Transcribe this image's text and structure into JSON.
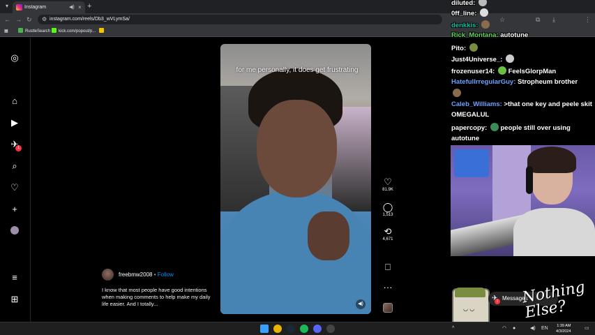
{
  "browser": {
    "tab": {
      "title": "Instagram",
      "audio_icon": "speaker-icon",
      "close_glyph": "×"
    },
    "new_tab_glyph": "+",
    "url": "instagram.com/reels/Db3_wVLymSa/",
    "bookmarks": [
      {
        "label": "RustleSearch",
        "icon": "rustle-icon",
        "color": "#4caf50"
      },
      {
        "label": "kick.com/popout/p...",
        "icon": "kick-icon",
        "color": "#53fc18"
      },
      {
        "label": "",
        "icon": "bookmark-folder-icon",
        "color": "#f5c400"
      }
    ]
  },
  "instagram": {
    "nav_icons": [
      "instagram-logo-icon",
      "home-icon",
      "reels-icon",
      "notifications-icon",
      "search-icon",
      "heart-icon",
      "create-icon",
      "profile-avatar",
      "menu-icon",
      "apps-icon"
    ],
    "notification_count": "1",
    "reel": {
      "caption_overlay": "for me personally, it does get frustrating",
      "likes": "81.9K",
      "comments": "1,513",
      "reposts": "4,671",
      "author": "freebmw2008",
      "separator": "•",
      "follow_label": "Follow",
      "description": "I know that most people have good intentions when making comments to help make my daily life easier. And I totally..."
    }
  },
  "chat": {
    "messages": [
      {
        "user": "diluted:",
        "text": "",
        "color": "#ffffff",
        "emote": "#bbbbbb"
      },
      {
        "user": "0ff_line:",
        "text": "",
        "color": "#ffffff",
        "emote": "#dddddd"
      },
      {
        "user": "denkkis:",
        "text": "",
        "color": "#00c2a8",
        "emote": "#8b6b4e"
      },
      {
        "user": "Rick_Montana:",
        "text": "autotune",
        "color": "#5bd75b",
        "emote": ""
      },
      {
        "user": "Pito:",
        "text": "",
        "color": "#ffffff",
        "emote": "#7a8c40"
      },
      {
        "user": "Just4Universe_:",
        "text": "",
        "color": "#ffffff",
        "emote": "#cccccc"
      },
      {
        "user": "frozenuser14:",
        "text": "FeelsGlorpMan",
        "color": "#ffffff",
        "emote": "#6abf40"
      },
      {
        "user": "HatefulIrregularGuy:",
        "text": "Stropheum brother",
        "color": "#6ea0ff",
        "emote": ""
      },
      {
        "user": "",
        "text": "",
        "color": "#ffffff",
        "emote": "#8b6b4e"
      },
      {
        "user": "Caleb_Williams:",
        "text": ">that one key and peele skit",
        "color": "#6ea0ff",
        "emote": ""
      },
      {
        "user": "",
        "text": "OMEGALUL",
        "color": "#ffffff",
        "emote": ""
      },
      {
        "user": "papercopy:",
        "text": "people still over using",
        "color": "#ffffff",
        "emote": "#3c8c5a"
      },
      {
        "user": "",
        "text": "autotune",
        "color": "#ffffff",
        "emote": ""
      }
    ]
  },
  "overlay": {
    "messages_label": "Messages",
    "messages_count": "1",
    "brand_text": "Nothing Else?"
  },
  "taskbar": {
    "apps": [
      {
        "name": "windows-start-icon",
        "color": "#3aa0ff"
      },
      {
        "name": "chrome-icon",
        "color": "#e8b400"
      },
      {
        "name": "steam-icon",
        "color": "#1b2838"
      },
      {
        "name": "spotify-icon",
        "color": "#1db954"
      },
      {
        "name": "discord-icon",
        "color": "#5865f2"
      },
      {
        "name": "obs-icon",
        "color": "#444444"
      }
    ],
    "clock_time": "1:39 AM",
    "clock_date": "4/3/2024"
  }
}
